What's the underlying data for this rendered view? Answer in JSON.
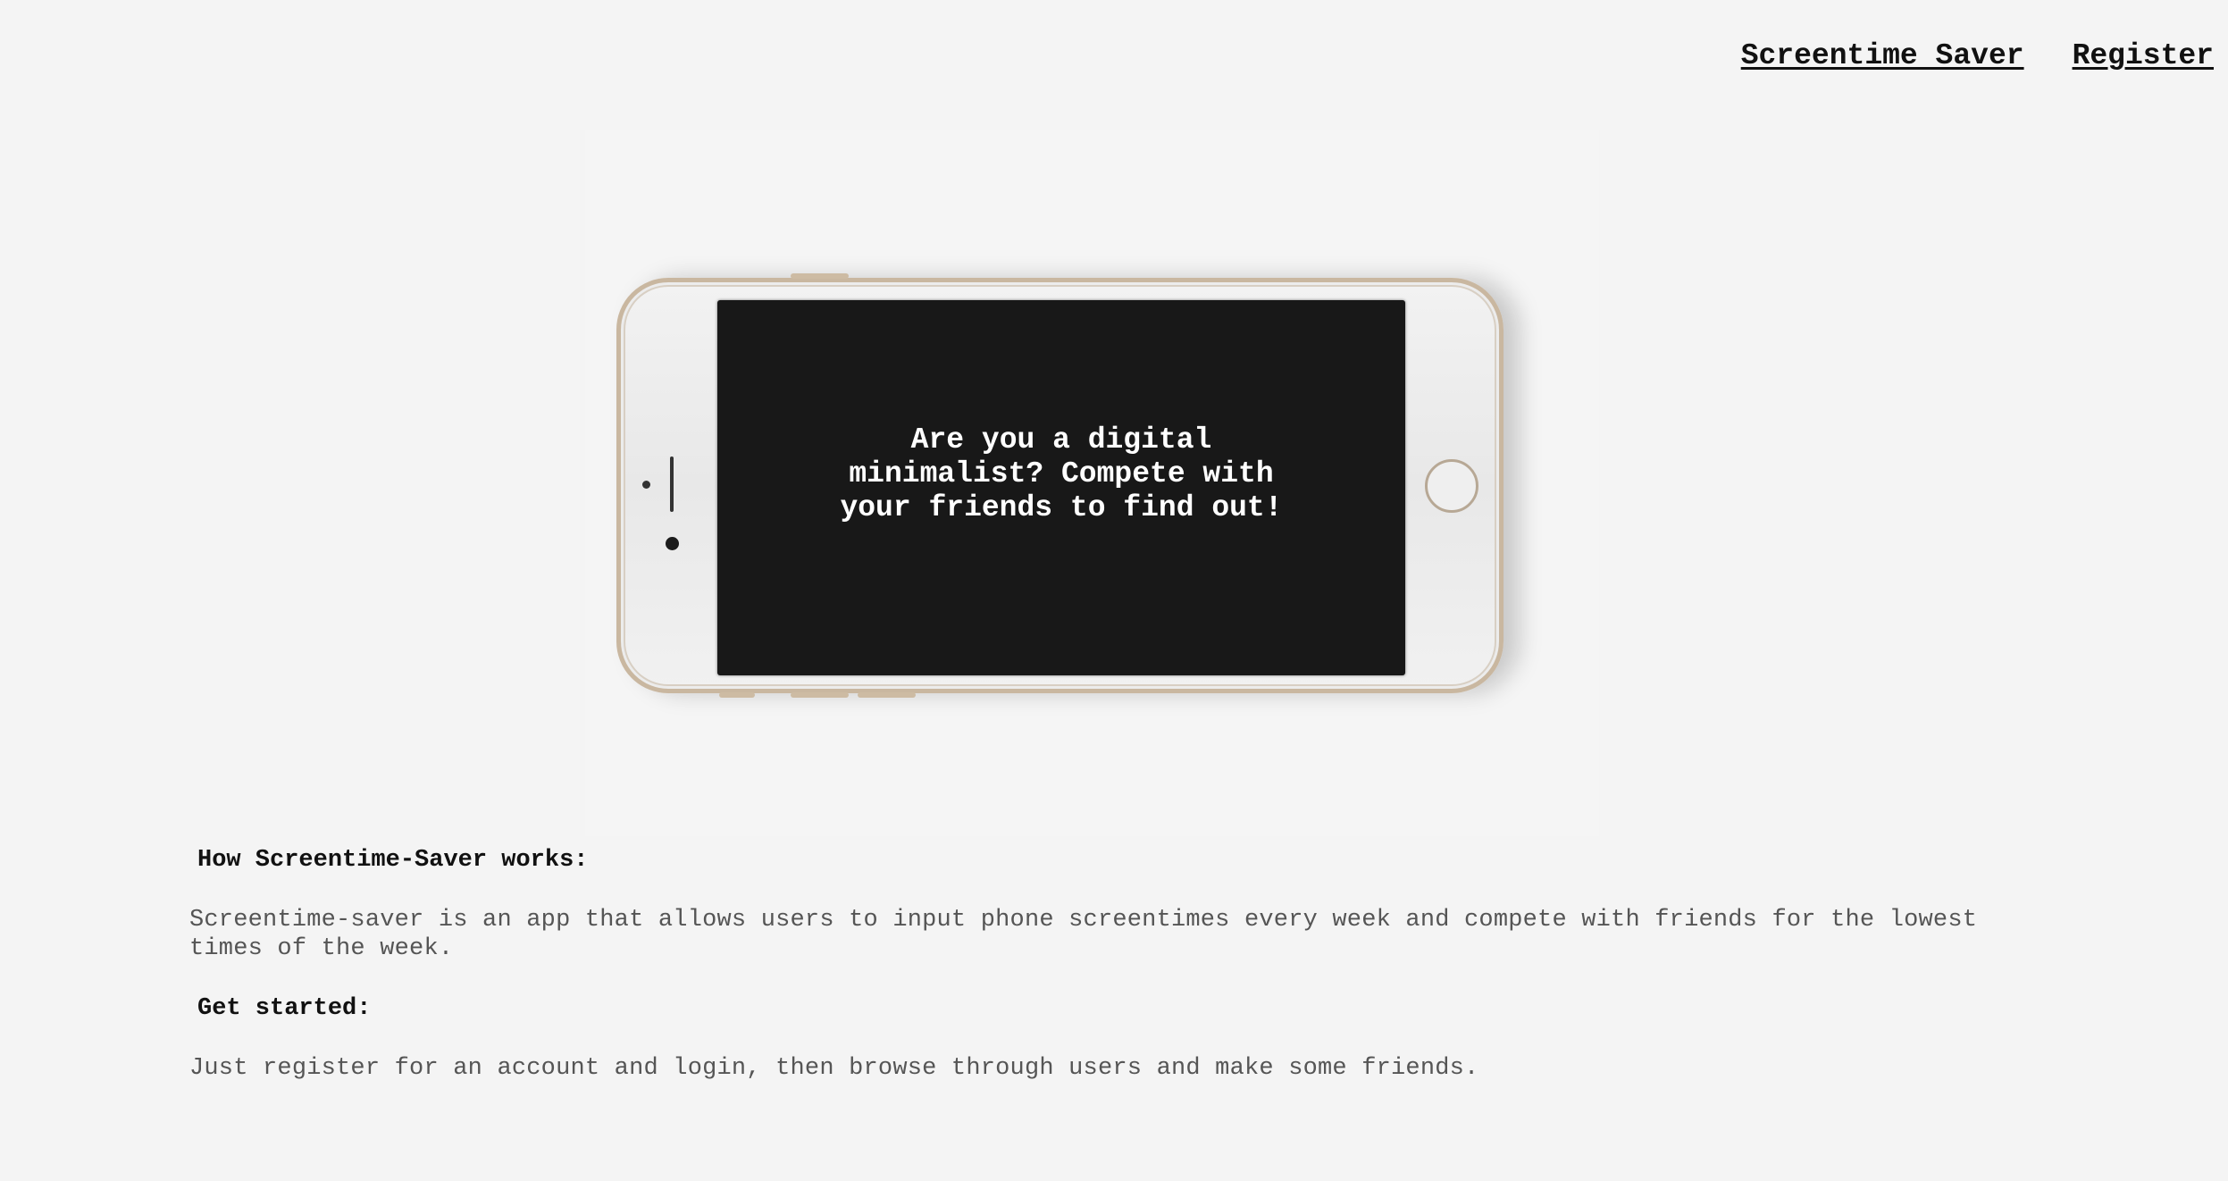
{
  "nav": {
    "brand_label": "Screentime Saver",
    "register_label": "Register"
  },
  "hero": {
    "screen_text": "Are you a digital minimalist? Compete with your friends to find out!"
  },
  "sections": {
    "how_heading": "How Screentime-Saver works:",
    "how_text": "Screentime-saver is an app that allows users to input phone screentimes every week and compete with friends for the lowest times of the week.",
    "start_heading": "Get started:",
    "start_text": "Just register for an account and login, then browse through users and make some friends."
  },
  "colors": {
    "background": "#f4f4f4",
    "screen": "#181818",
    "phone_frame": "#c9b7a0"
  }
}
